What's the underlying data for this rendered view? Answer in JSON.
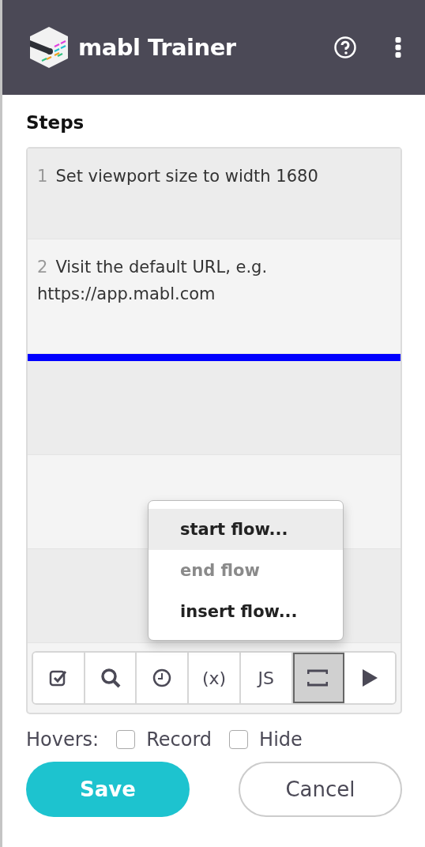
{
  "header": {
    "title": "mabl Trainer"
  },
  "steps_title": "Steps",
  "rows": [
    {
      "kind": "step",
      "number": "1",
      "text": "Set viewport size to width 1680"
    },
    {
      "kind": "step",
      "number": "2",
      "text": "Visit the default URL, e.g. https://app.mabl.com"
    },
    {
      "kind": "insertion"
    },
    {
      "kind": "empty"
    },
    {
      "kind": "empty"
    },
    {
      "kind": "empty"
    }
  ],
  "tools": [
    {
      "kind": "check",
      "selected": false
    },
    {
      "kind": "search",
      "selected": false
    },
    {
      "kind": "clock",
      "selected": false
    },
    {
      "kind": "text",
      "label": "(x)",
      "selected": false
    },
    {
      "kind": "text",
      "label": "JS",
      "selected": false
    },
    {
      "kind": "flow",
      "selected": true
    },
    {
      "kind": "play",
      "selected": false
    }
  ],
  "menu": [
    {
      "label": "start flow...",
      "highlighted": true,
      "disabled": false
    },
    {
      "label": "end flow",
      "highlighted": false,
      "disabled": true
    },
    {
      "label": "insert flow...",
      "highlighted": false,
      "disabled": false
    }
  ],
  "hovers": {
    "label": "Hovers:",
    "options": [
      {
        "label": "Record",
        "checked": false
      },
      {
        "label": "Hide",
        "checked": false
      }
    ]
  },
  "buttons": {
    "save": "Save",
    "cancel": "Cancel"
  }
}
